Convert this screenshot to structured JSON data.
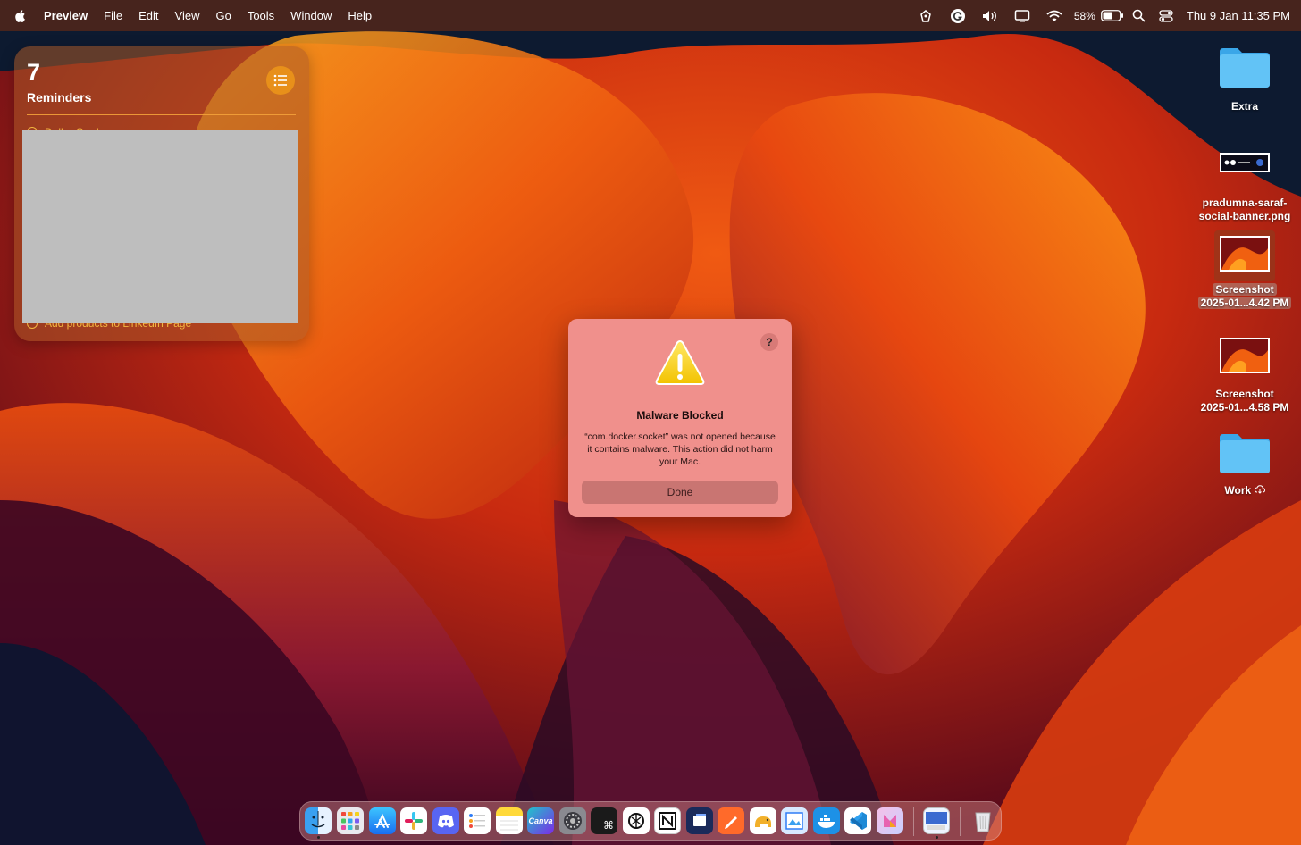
{
  "menubar": {
    "app_name": "Preview",
    "menus": [
      "File",
      "Edit",
      "View",
      "Go",
      "Tools",
      "Window",
      "Help"
    ],
    "battery_percent": "58%",
    "clock": "Thu 9 Jan  11:35 PM"
  },
  "reminders_widget": {
    "count": "7",
    "title": "Reminders",
    "partial_item_top": "Dollar Card",
    "partial_item_bottom": "Add products to LinkedIn Page"
  },
  "desktop_icons": [
    {
      "label": "Extra"
    },
    {
      "label": "pradumna-saraf-social-banner.png"
    },
    {
      "label_line1": "Screenshot",
      "label_line2": "2025-01...4.42 PM"
    },
    {
      "label_line1": "Screenshot",
      "label_line2": "2025-01...4.58 PM"
    },
    {
      "label": "Work"
    }
  ],
  "dialog": {
    "title": "Malware Blocked",
    "message": "“com.docker.socket” was not opened because it contains malware. This action did not harm your Mac.",
    "done_label": "Done",
    "help_label": "?"
  },
  "dock": {
    "canva_label": "Canva",
    "terminal_label": "⌘"
  },
  "colors": {
    "dialog_bg": "#f0908c",
    "menubar": "#7a2d0f",
    "reminders_accent": "#f2b640"
  }
}
